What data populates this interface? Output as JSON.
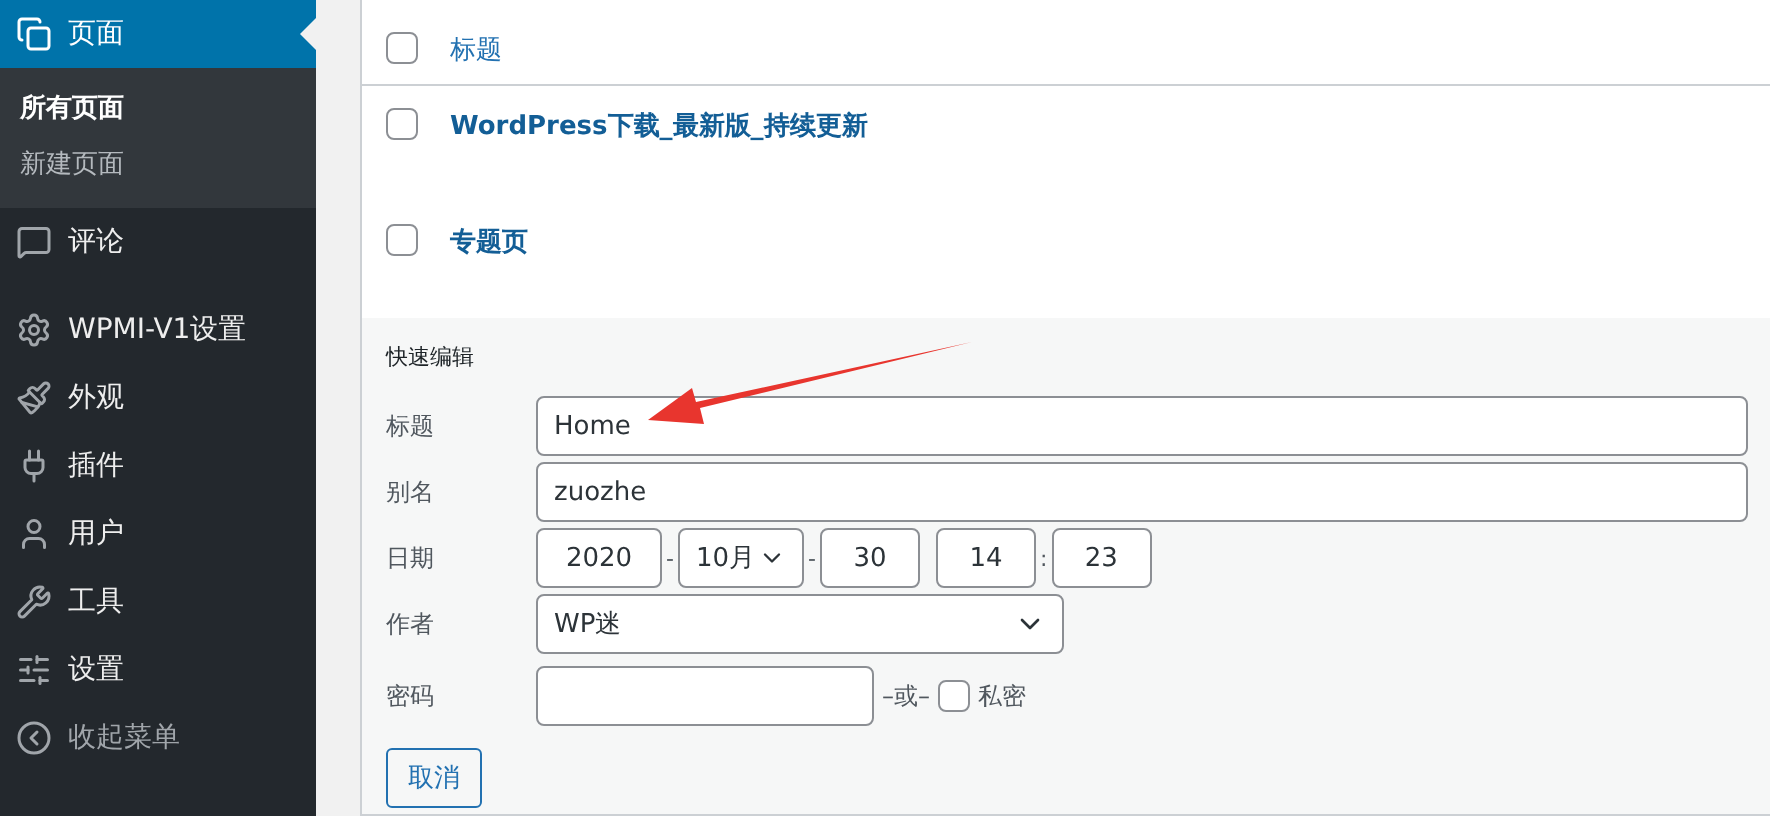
{
  "sidebar": {
    "items": [
      {
        "label": "页面",
        "selected": true,
        "children": [
          {
            "label": "所有页面",
            "selected": true
          },
          {
            "label": "新建页面",
            "selected": false
          }
        ]
      },
      {
        "label": "评论",
        "selected": false
      },
      {
        "label": "WPMI-V1设置",
        "selected": false
      },
      {
        "label": "外观",
        "selected": false
      },
      {
        "label": "插件",
        "selected": false
      },
      {
        "label": "用户",
        "selected": false
      },
      {
        "label": "工具",
        "selected": false
      },
      {
        "label": "设置",
        "selected": false
      }
    ],
    "collapse": "收起菜单"
  },
  "table": {
    "header": {
      "label": "标题",
      "checked": false
    },
    "rows": [
      {
        "title": "WordPress下载_最新版_持续更新",
        "checked": false
      },
      {
        "title": "专题页",
        "checked": false
      }
    ]
  },
  "quick_edit": {
    "heading": "快速编辑",
    "title": {
      "label": "标题",
      "value": "Home"
    },
    "slug": {
      "label": "别名",
      "value": "zuozhe"
    },
    "date": {
      "label": "日期",
      "year": "2020",
      "sep_1": "-",
      "month": "10月",
      "sep_2": "-",
      "day": "30",
      "hour": "14",
      "time_sep": ":",
      "minute": "23"
    },
    "author": {
      "label": "作者",
      "value": "WP迷"
    },
    "password": {
      "label": "密码",
      "or": "–或–",
      "private_label": "私密",
      "private_checked": false
    },
    "cancel": "取消"
  }
}
